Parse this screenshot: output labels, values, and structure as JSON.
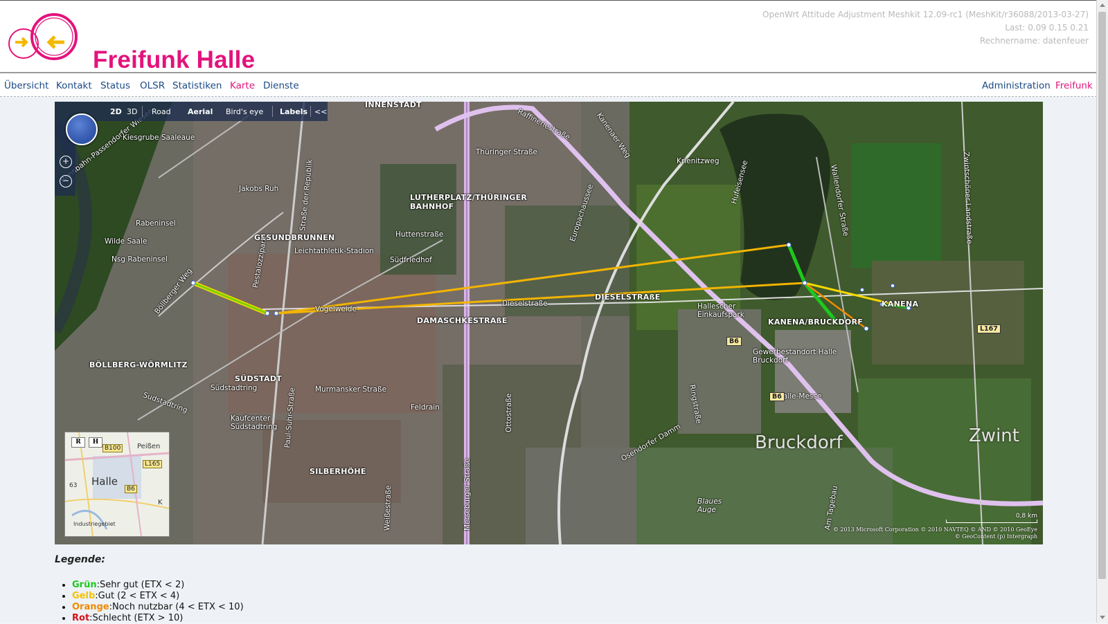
{
  "header": {
    "brand": "Freifunk Halle",
    "system": "OpenWrt Attitude Adjustment Meshkit 12.09-rc1 (MeshKit/r36088/2013-03-27)",
    "load": "Last: 0.09 0.15 0.21",
    "hostname": "Rechnername: datenfeuer"
  },
  "nav": {
    "left": [
      "Übersicht",
      "Kontakt",
      "Status",
      "OLSR",
      "Statistiken",
      "Karte",
      "Dienste"
    ],
    "right": [
      "Administration",
      "Freifunk"
    ],
    "active": "Karte"
  },
  "map": {
    "toolbar": [
      "2D",
      "3D",
      "Road",
      "Aerial",
      "Bird's eye",
      "Labels",
      "<<"
    ],
    "labels": [
      "Kiesgrube Saaleaue",
      "Rennbahn-Passendorfer Wiesen",
      "Jakobs Ruh",
      "Rabeninsel",
      "Wilde Saale",
      "Nsg Rabeninsel",
      "Böllberger Weg",
      "GESUNDBRUNNEN",
      "Leichtathletik-Stadion",
      "LUTHERPLATZ/THÜRINGER BAHNHOF",
      "Huttenstraße",
      "Südfriedhof",
      "Thüringer Straße",
      "Raffineriestraße",
      "INNENSTADT",
      "Vogelweide",
      "Dieselstraße",
      "DIESELSTRAßE",
      "DAMASCHKESTRAßE",
      "Merseburger Straße",
      "BÖLLBERG-WÖRMLITZ",
      "SÜDSTADT",
      "Südstadtring",
      "Kaufcenter Südstadtring",
      "Murmansker Straße",
      "Feldrain",
      "SILBERHÖHE",
      "Ottostraße",
      "Europachaussee",
      "Osendorfer Damm",
      "Kanenaer Weg",
      "Krienitzweg",
      "Hufeisensee",
      "Wallendorfer Straße",
      "Zwintschöner Landstraße",
      "Hallescher Einkaufspark",
      "KANENA/BRUCKDORF",
      "KANENA",
      "Gewerbestandort Halle Bruckdorf",
      "Halle-Messe",
      "Bruckdorf",
      "Zwint",
      "Blaues Auge",
      "Am Tagebau",
      "Ringstraße",
      "Sudstadtring",
      "Paul-Suhr-Straße",
      "Weißestraße",
      "Pestalozzipark",
      "Straße der Republik"
    ],
    "shields": [
      "B6",
      "B6",
      "L167"
    ],
    "minimap": {
      "buttons": [
        "R",
        "H"
      ],
      "city": "Halle",
      "labels": [
        "Peißen",
        "Industriegebiet",
        "K",
        "63"
      ],
      "shields": [
        "B100",
        "L165",
        "B6"
      ]
    },
    "scale": "0,8 km",
    "copyright": [
      "© 2013 Microsoft Corporation   © 2010 NAVTEQ   © AND   © 2010 GeoEye",
      "© GeoContent (p) Intergraph"
    ]
  },
  "legend": {
    "title": "Legende:",
    "items": [
      {
        "color_name": "Grün",
        "text": "Sehr gut (ETX < 2)",
        "color": "#1ec81e"
      },
      {
        "color_name": "Gelb",
        "text": "Gut (2 < ETX < 4)",
        "color": "#f5c200"
      },
      {
        "color_name": "Orange",
        "text": "Noch nutzbar (4 < ETX < 10)",
        "color": "#f08a00"
      },
      {
        "color_name": "Rot",
        "text": "Schlecht (ETX > 10)",
        "color": "#d9111b"
      }
    ]
  },
  "colors": {
    "brand": "#e3137b",
    "nav_link": "#1a4a86"
  }
}
